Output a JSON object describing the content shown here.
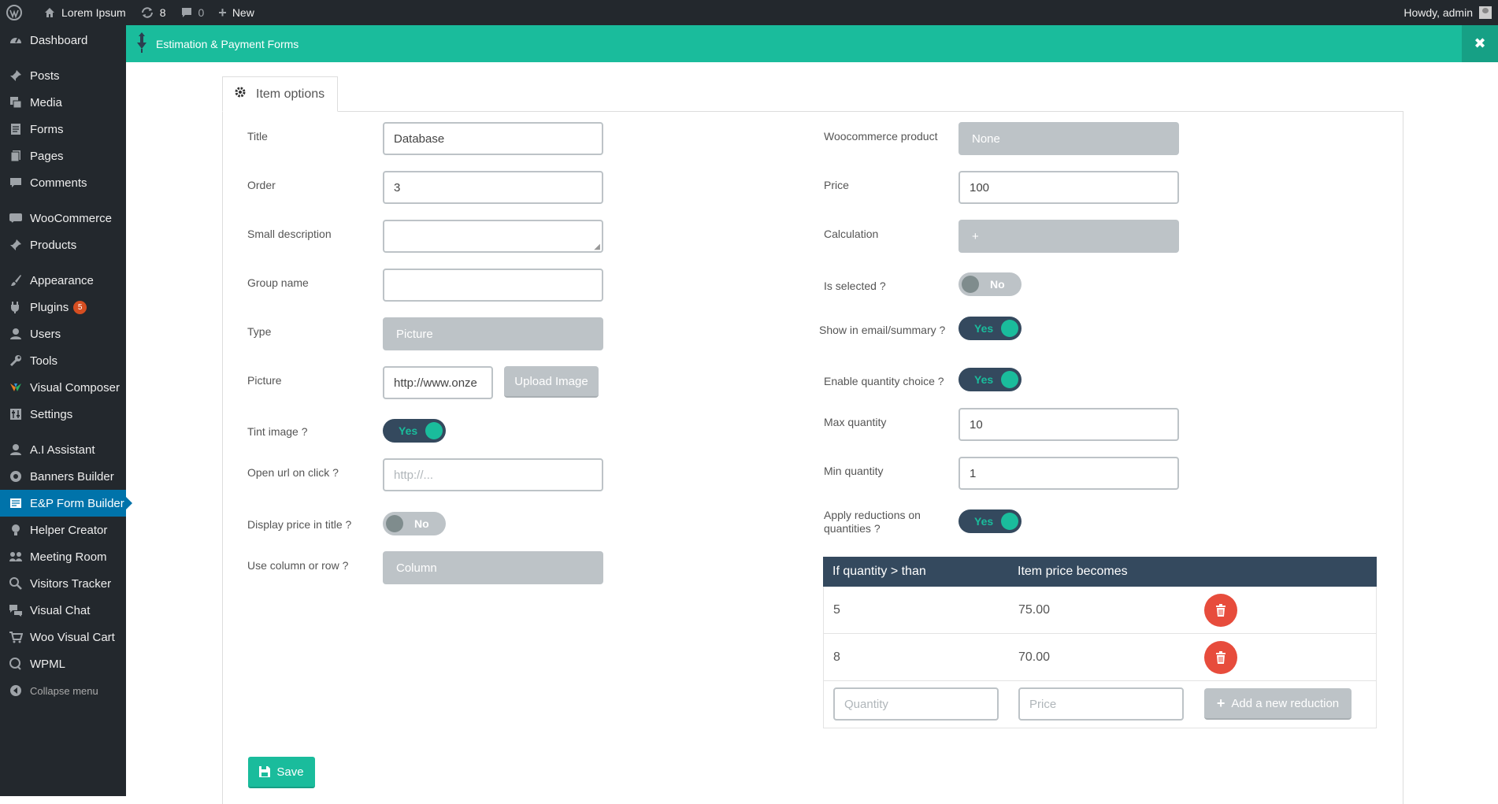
{
  "adminbar": {
    "site_name": "Lorem Ipsum",
    "updates_count": "8",
    "comments_count": "0",
    "new_label": "New",
    "howdy": "Howdy, admin"
  },
  "sidebar": {
    "items": [
      {
        "label": "Dashboard",
        "icon": "dashboard-icon"
      },
      {
        "label": "Posts",
        "icon": "pin-icon"
      },
      {
        "label": "Media",
        "icon": "media-icon"
      },
      {
        "label": "Forms",
        "icon": "forms-icon"
      },
      {
        "label": "Pages",
        "icon": "pages-icon"
      },
      {
        "label": "Comments",
        "icon": "comments-icon"
      },
      {
        "label": "WooCommerce",
        "icon": "woocommerce-icon"
      },
      {
        "label": "Products",
        "icon": "products-icon"
      },
      {
        "label": "Appearance",
        "icon": "brush-icon"
      },
      {
        "label": "Plugins",
        "icon": "plugin-icon",
        "badge": "5"
      },
      {
        "label": "Users",
        "icon": "user-icon"
      },
      {
        "label": "Tools",
        "icon": "wrench-icon"
      },
      {
        "label": "Visual Composer",
        "icon": "visual-composer-icon"
      },
      {
        "label": "Settings",
        "icon": "settings-icon"
      },
      {
        "label": "A.I Assistant",
        "icon": "assistant-icon"
      },
      {
        "label": "Banners Builder",
        "icon": "banner-icon"
      },
      {
        "label": "E&P Form Builder",
        "icon": "form-builder-icon"
      },
      {
        "label": "Helper Creator",
        "icon": "bulb-icon"
      },
      {
        "label": "Meeting Room",
        "icon": "meeting-icon"
      },
      {
        "label": "Visitors Tracker",
        "icon": "search-icon"
      },
      {
        "label": "Visual Chat",
        "icon": "chat-icon"
      },
      {
        "label": "Woo Visual Cart",
        "icon": "cart-icon"
      },
      {
        "label": "WPML",
        "icon": "wpml-icon"
      }
    ],
    "collapse_label": "Collapse menu"
  },
  "header": {
    "title": "Estimation & Payment Forms"
  },
  "tab": {
    "label": "Item options"
  },
  "left_form": {
    "title_label": "Title",
    "title_value": "Database",
    "order_label": "Order",
    "order_value": "3",
    "small_desc_label": "Small description",
    "small_desc_value": "",
    "group_label": "Group name",
    "group_value": "",
    "type_label": "Type",
    "type_value": "Picture",
    "picture_label": "Picture",
    "picture_value": "http://www.onze",
    "upload_label": "Upload Image",
    "tint_label": "Tint image ?",
    "tint_value": "Yes",
    "open_url_label": "Open url on click ?",
    "open_url_placeholder": "http://...",
    "display_price_label": "Display price in title ?",
    "display_price_value": "No",
    "column_label": "Use column or row ?",
    "column_value": "Column"
  },
  "right_form": {
    "woo_label": "Woocommerce product",
    "woo_value": "None",
    "price_label": "Price",
    "price_value": "100",
    "calc_label": "Calculation",
    "calc_value": "+",
    "selected_label": "Is selected ?",
    "selected_value": "No",
    "show_email_label": "Show in email/summary ?",
    "show_email_value": "Yes",
    "qty_choice_label": "Enable quantity choice ?",
    "qty_choice_value": "Yes",
    "max_qty_label": "Max quantity",
    "max_qty_value": "10",
    "min_qty_label": "Min quantity",
    "min_qty_value": "1",
    "apply_red_label_1": "Apply reductions on",
    "apply_red_label_2": "quantities ?",
    "apply_red_value": "Yes"
  },
  "reductions": {
    "headers": [
      "If quantity > than",
      "Item price becomes"
    ],
    "rows": [
      {
        "qty": "5",
        "price": "75.00"
      },
      {
        "qty": "8",
        "price": "70.00"
      }
    ],
    "qty_placeholder": "Quantity",
    "price_placeholder": "Price",
    "add_label": "Add a new reduction"
  },
  "footer": {
    "save_label": "Save"
  },
  "colors": {
    "accent": "#1abc9c",
    "dark": "#34495e",
    "danger": "#e74c3c",
    "sidebar": "#23282d",
    "active": "#0073aa"
  }
}
